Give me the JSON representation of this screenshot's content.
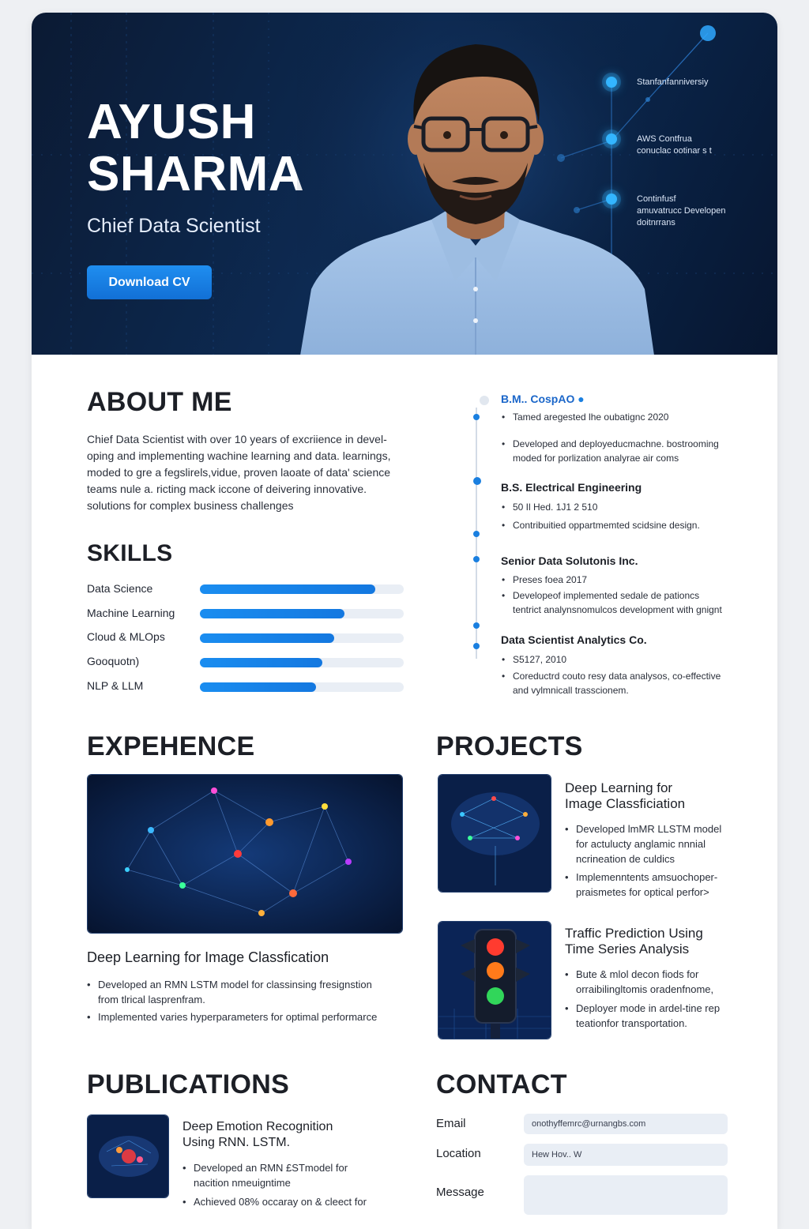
{
  "hero": {
    "name_line1": "AYUSH",
    "name_line2": "SHARMA",
    "title": "Chief Data Scientist",
    "download_label": "Download CV",
    "credentials": [
      {
        "line1": "Stanfanfanniversiy",
        "line2": ""
      },
      {
        "line1": "AWS Contfrua",
        "line2": "conuclac ootinar s t"
      },
      {
        "line1": "Continfusf",
        "line2": "amuvatrucc Developen",
        "line3": "doitnrrans"
      }
    ]
  },
  "about": {
    "heading": "ABOUT ME",
    "lines": [
      "Chief Data Scientist with over 10 years of excriience in devel-",
      "oping and implementing wachine learning and data. learnings,",
      "moded to gre a fegslirels,vidue, proven laoate of data' science",
      "teams nule a. ricting mack iccone of deivering innovative.",
      "solutions for complex business challenges"
    ]
  },
  "skills": {
    "heading": "SKILLS",
    "items": [
      {
        "label": "Data Science",
        "level": 0.86
      },
      {
        "label": "Machine Learning",
        "level": 0.71
      },
      {
        "label": "Cloud & MLOps",
        "level": 0.66
      },
      {
        "label": "Gooquotn)",
        "level": 0.6
      },
      {
        "label": "NLP & LLM",
        "level": 0.57
      }
    ]
  },
  "timeline": [
    {
      "head": "B.M.. CospAO",
      "bullets": [
        [
          "Tamed aregested lhe oubatignc 2020"
        ],
        [
          "Developed and deployeducmachne. bostrooming",
          "moded for porlization analyrae air coms"
        ]
      ]
    },
    {
      "head": "B.S. Electrical Engineering",
      "bullets": [
        [
          "50 Il Hed. 1J1 2 510"
        ],
        [
          "Contribuitied oppartmemted scidsine design."
        ]
      ]
    },
    {
      "head": "Senior Data Solutonis Inc.",
      "bullets": [
        [
          "Preses foea 2017"
        ],
        [
          "Developeof implemented sedale de pationcs",
          "tentrict analynsnomulcos development with gnignt"
        ]
      ]
    },
    {
      "head": "Data Scientist Analytics Co.",
      "bullets": [
        [
          "S5127, 2010"
        ],
        [
          "Coreductrd couto resy data analysos, co-effective",
          "and vylmnicall trasscionem."
        ]
      ]
    }
  ],
  "experience": {
    "heading": "EXPEHENCE",
    "title": "Deep Learning for Image Classfication",
    "bullets": [
      [
        "Developed an RMN LSTM model for classinsing fresignstion",
        "from tlrical lasprenfram."
      ],
      [
        "Implemented varies hyperparameters for optimal performarce"
      ]
    ]
  },
  "projects": {
    "heading": "PROJECTS",
    "items": [
      {
        "title_line1": "Deep Learning for",
        "title_line2": "Image Classficiation",
        "bullets": [
          [
            "Developed lmMR LLSTM model",
            "for actulucty anglamic nnnial",
            "ncrineation de culdics"
          ],
          [
            "Implemenntents amsuochoper-",
            "praismetes for optical perfor>"
          ]
        ]
      },
      {
        "title_line1": "Traffic Prediction Using",
        "title_line2": "Time Series Analysis",
        "bullets": [
          [
            "Bute & mlol decon fiods for",
            "orraibilingltomis oradenfnome,"
          ],
          [
            "Deployer mode in ardel-tine rep",
            "teationfor transportation."
          ]
        ]
      }
    ]
  },
  "publications": {
    "heading": "PUBLICATIONS",
    "title_line1": "Deep Emotion Recognition",
    "title_line2": "Using RNN. LSTM.",
    "bullets": [
      [
        "Developed an RMN £STmodel for",
        "nacition nmeuigntime"
      ],
      [
        "Achieved 08% occaray on & cleect for"
      ]
    ]
  },
  "contact": {
    "heading": "CONTACT",
    "email_label": "Email",
    "email_value": "onothyffemrc@urnangbs.com",
    "location_label": "Location",
    "location_value": "Hew Hov.. W",
    "message_label": "Message"
  },
  "colors": {
    "accent": "#1a8df0",
    "hero_bg": "#0b1a33"
  }
}
